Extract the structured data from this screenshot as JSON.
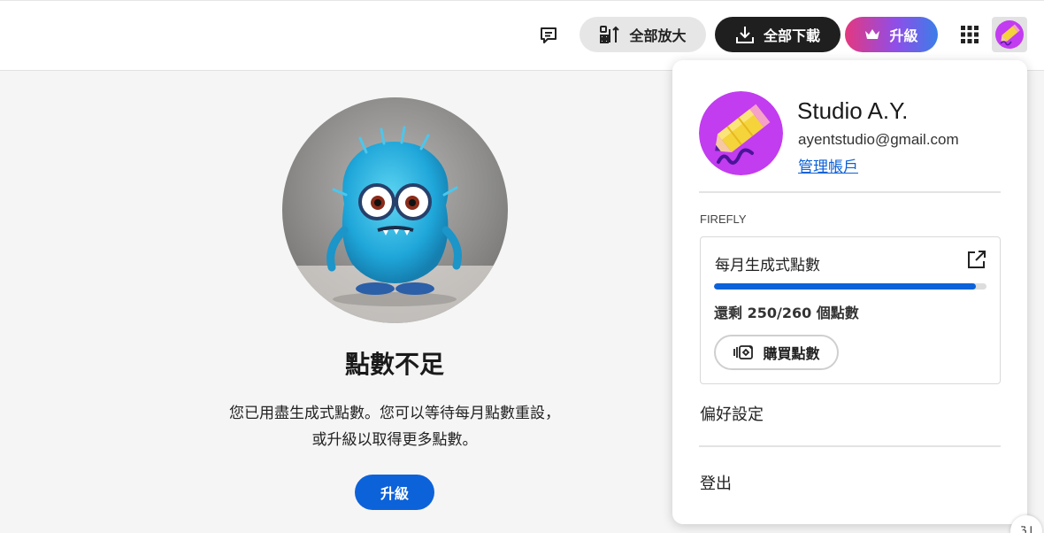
{
  "toolbar": {
    "comment_icon": "comment-icon",
    "zoom_all_label": "全部放大",
    "download_all_label": "全部下載",
    "upgrade_label": "升級",
    "apps_icon": "app-grid-icon"
  },
  "main": {
    "title": "點數不足",
    "desc_line1": "您已用盡生成式點數。您可以等待每月點數重設，",
    "desc_line2": "或升級以取得更多點數。",
    "upgrade_label": "升級"
  },
  "account": {
    "name": "Studio A.Y.",
    "email": "ayentstudio@gmail.com",
    "manage_label": "管理帳戶",
    "section_label": "FIREFLY",
    "credits_title": "每月生成式點數",
    "credits_fraction": 0.962,
    "credits_remaining_text": "還剩 250/260 個點數",
    "buy_label": "購買點數",
    "preferences_label": "偏好設定",
    "signout_label": "登出"
  },
  "corner_badge_text": "ℨ⅃",
  "colors": {
    "accent_blue": "#0c62d9",
    "upgrade_gradient_start": "#e4387f",
    "upgrade_gradient_end": "#3b7ee8",
    "avatar_purple": "#c23cf0",
    "avatar_pencil_yellow": "#f5d33b"
  }
}
